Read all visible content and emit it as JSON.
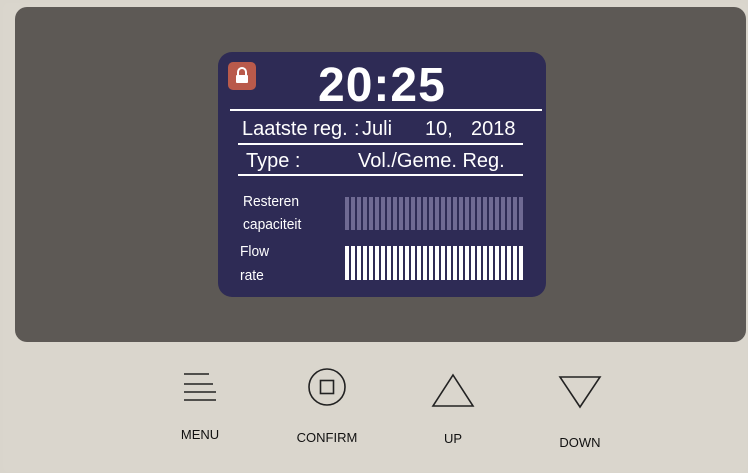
{
  "screen": {
    "time": "20:25",
    "last_reg_label": "Laatste reg.",
    "last_reg_sep": ":",
    "last_reg_month": "Juli",
    "last_reg_day": "10,",
    "last_reg_year": "2018",
    "type_label": "Type :",
    "type_value": "Vol./Geme. Reg.",
    "remaining_label_1": "Resteren",
    "remaining_label_2": "capaciteit",
    "flow_label_1": "Flow",
    "flow_label_2": "rate",
    "remaining_level": 1.0,
    "flow_level": 1.0
  },
  "buttons": {
    "menu": "MENU",
    "confirm": "CONFIRM",
    "up": "UP",
    "down": "DOWN"
  },
  "icons": {
    "lock": "lock-icon",
    "menu": "hamburger-icon",
    "confirm": "square-in-circle-icon",
    "up": "triangle-up-icon",
    "down": "triangle-down-icon"
  },
  "colors": {
    "panel": "#5d5955",
    "lcd": "#2e2b55",
    "lock_badge": "#b95a4b",
    "remaining_bar": "#6f6a93",
    "flow_bar": "#ffffff"
  }
}
